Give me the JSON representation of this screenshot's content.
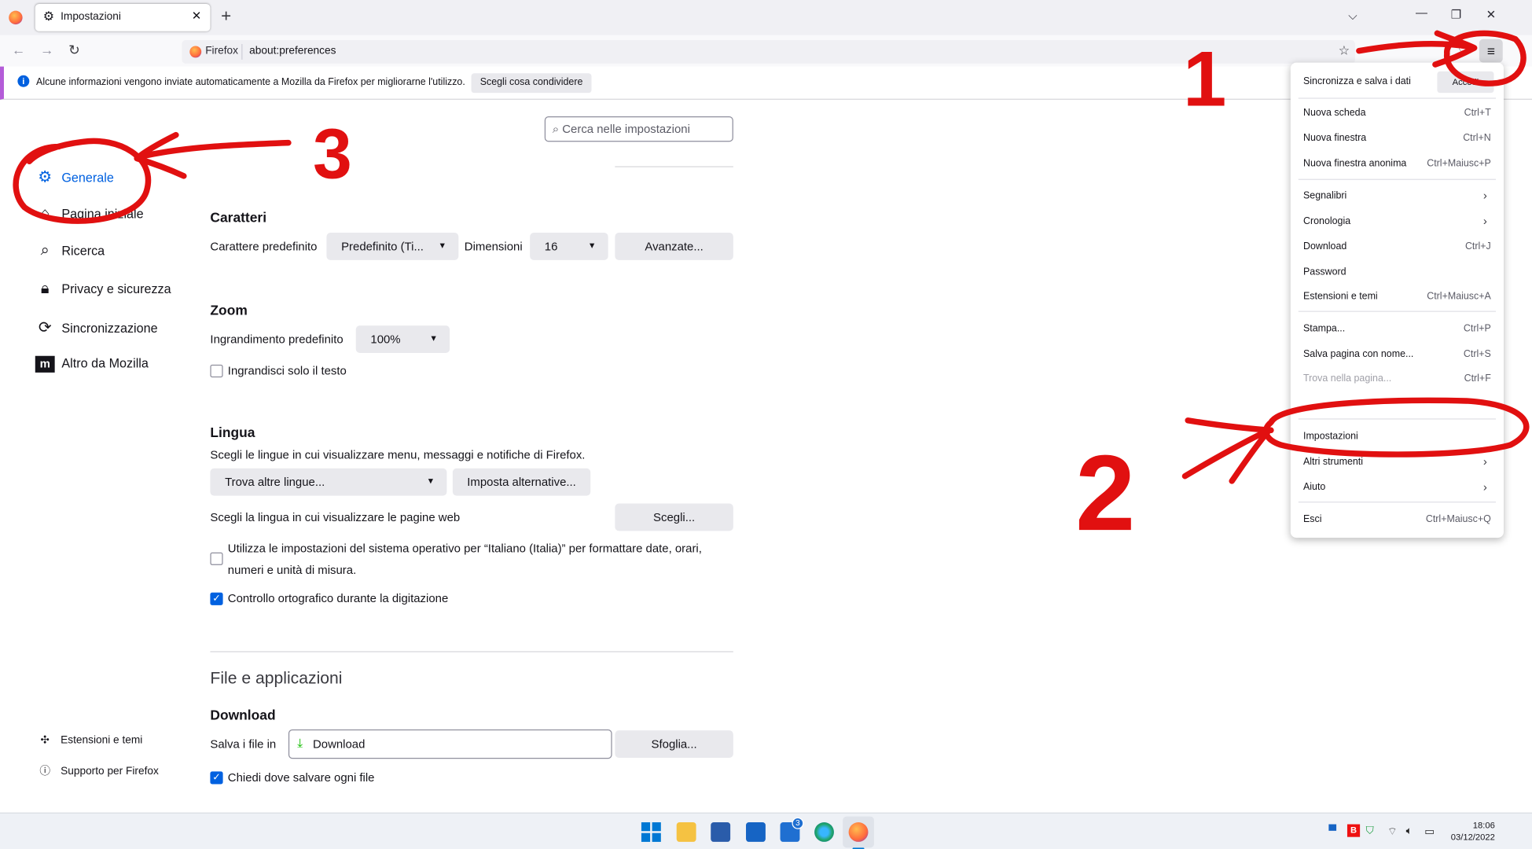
{
  "browser": {
    "tab_title": "Impostazioni",
    "identity_label": "Firefox",
    "url": "about:preferences"
  },
  "infobar": {
    "text": "Alcune informazioni vengono inviate automaticamente a Mozilla da Firefox per migliorarne l'utilizzo.",
    "button": "Scegli cosa condividere"
  },
  "sidebar": {
    "items": [
      {
        "label": "Generale",
        "icon": "gear-icon"
      },
      {
        "label": "Pagina iniziale",
        "icon": "home-icon"
      },
      {
        "label": "Ricerca",
        "icon": "search-icon"
      },
      {
        "label": "Privacy e sicurezza",
        "icon": "lock-icon"
      },
      {
        "label": "Sincronizzazione",
        "icon": "sync-icon"
      },
      {
        "label": "Altro da Mozilla",
        "icon": "mozilla-icon"
      }
    ],
    "footer": [
      {
        "label": "Estensioni e temi",
        "icon": "puzzle-icon"
      },
      {
        "label": "Supporto per Firefox",
        "icon": "help-icon"
      }
    ]
  },
  "search": {
    "placeholder": "Cerca nelle impostazioni"
  },
  "caratteri": {
    "heading": "Caratteri",
    "default_font_label": "Carattere predefinito",
    "default_font_value": "Predefinito (Ti...",
    "size_label": "Dimensioni",
    "size_value": "16",
    "advanced_button": "Avanzate..."
  },
  "zoom": {
    "heading": "Zoom",
    "default_label": "Ingrandimento predefinito",
    "default_value": "100%",
    "text_only_label": "Ingrandisci solo il testo",
    "text_only_checked": false
  },
  "lingua": {
    "heading": "Lingua",
    "description": "Scegli le lingue in cui visualizzare menu, messaggi e notifiche di Firefox.",
    "more_languages": "Trova altre lingue...",
    "set_alternatives": "Imposta alternative...",
    "web_pages_label": "Scegli la lingua in cui visualizzare le pagine web",
    "choose_button": "Scegli...",
    "os_settings_line1": "Utilizza le impostazioni del sistema operativo per “Italiano (Italia)” per formattare date, orari,",
    "os_settings_line2": "numeri e unità di misura.",
    "os_settings_checked": false,
    "spellcheck_label": "Controllo ortografico durante la digitazione",
    "spellcheck_checked": true
  },
  "files": {
    "section_title": "File e applicazioni",
    "download_heading": "Download",
    "save_label": "Salva i file in",
    "save_value": "Download",
    "browse_button": "Sfoglia...",
    "ask_label": "Chiedi dove salvare ogni file",
    "ask_checked": true
  },
  "appmenu": {
    "sync_label": "Sincronizza e salva i dati",
    "sign_in": "Accedi",
    "items": [
      {
        "label": "Nuova scheda",
        "shortcut": "Ctrl+T"
      },
      {
        "label": "Nuova finestra",
        "shortcut": "Ctrl+N"
      },
      {
        "label": "Nuova finestra anonima",
        "shortcut": "Ctrl+Maiusc+P"
      },
      {
        "label": "Segnalibri",
        "shortcut": ""
      },
      {
        "label": "Cronologia",
        "shortcut": ""
      },
      {
        "label": "Download",
        "shortcut": "Ctrl+J"
      },
      {
        "label": "Password",
        "shortcut": ""
      },
      {
        "label": "Estensioni e temi",
        "shortcut": "Ctrl+Maiusc+A"
      },
      {
        "label": "Stampa...",
        "shortcut": "Ctrl+P"
      },
      {
        "label": "Salva pagina con nome...",
        "shortcut": "Ctrl+S"
      },
      {
        "label": "Trova nella pagina...",
        "shortcut": "Ctrl+F"
      },
      {
        "label": "Impostazioni",
        "shortcut": ""
      },
      {
        "label": "Altri strumenti",
        "shortcut": ""
      },
      {
        "label": "Aiuto",
        "shortcut": ""
      },
      {
        "label": "Esci",
        "shortcut": "Ctrl+Maiusc+Q"
      }
    ]
  },
  "taskbar": {
    "mail_badge": "3",
    "time": "18:06",
    "date": "03/12/2022"
  },
  "colors": {
    "accent": "#0061e0",
    "annotation": "#e11010"
  },
  "annotations": {
    "mark_1": "1",
    "mark_2": "2",
    "mark_3": "3"
  }
}
